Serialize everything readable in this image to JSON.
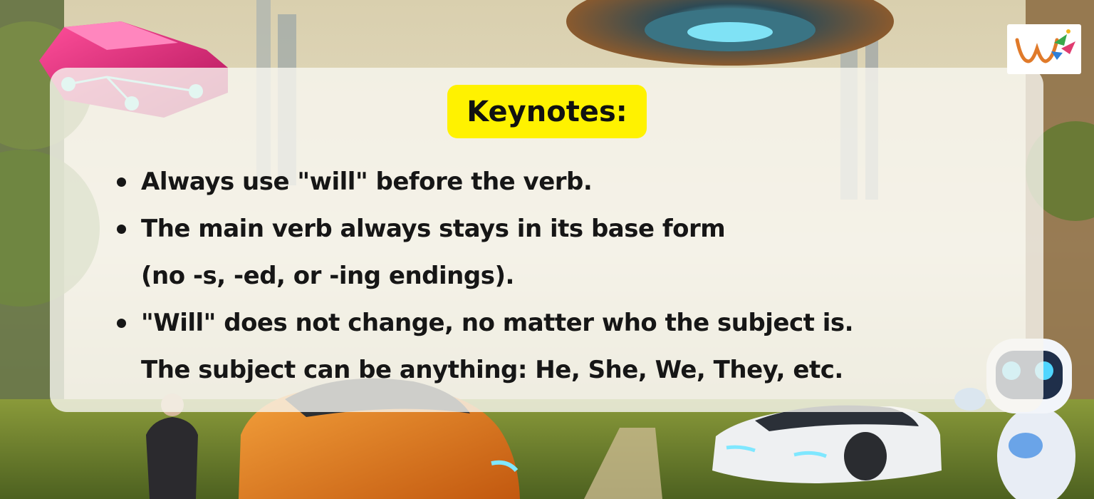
{
  "heading": "Keynotes:",
  "keynotes": [
    {
      "lines": [
        "Always use \"will\" before the verb."
      ]
    },
    {
      "lines": [
        "The main verb always stays in its base form",
        "(no -s, -ed, or -ing endings)."
      ]
    },
    {
      "lines": [
        "\"Will\" does not change, no matter who the subject is.",
        "The subject can be anything: He, She, We, They, etc."
      ]
    }
  ],
  "colors": {
    "heading_highlight": "#fff200",
    "panel_background": "rgba(248,246,240,0.80)",
    "text": "#161616"
  },
  "icons": [
    "brand-logo",
    "flying-car-illustration",
    "ufo-illustration",
    "robot-mascot",
    "orange-car-illustration",
    "white-car-illustration"
  ]
}
